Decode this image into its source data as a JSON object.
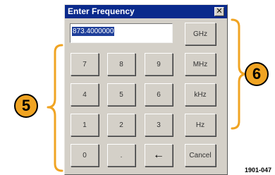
{
  "dialog": {
    "title": "Enter Frequency",
    "close_glyph": "✕",
    "close_icon": "close-icon"
  },
  "frequency": {
    "value": "873.4000000"
  },
  "units": {
    "ghz": "GHz",
    "mhz": "MHz",
    "khz": "kHz",
    "hz": "Hz",
    "cancel": "Cancel"
  },
  "keypad": {
    "k7": "7",
    "k8": "8",
    "k9": "9",
    "k4": "4",
    "k5": "5",
    "k6": "6",
    "k1": "1",
    "k2": "2",
    "k3": "3",
    "k0": "0",
    "dot": ".",
    "backspace_glyph": "←",
    "backspace_icon": "left-arrow-icon"
  },
  "callouts": {
    "keypad": "5",
    "units": "6"
  },
  "colors": {
    "accent": "#f0a423",
    "titlebar": "#0a2a8c",
    "selection": "#1f3f9a"
  },
  "figure_id": "1901-047"
}
